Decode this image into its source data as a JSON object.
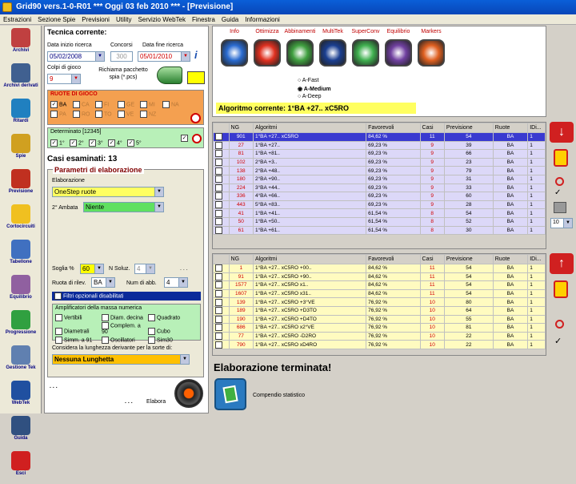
{
  "window": {
    "title": "Grid90 vers.1-0-R01  ***  Oggi 03 feb 2010  ***  - [Previsione]"
  },
  "menu": [
    "Estrazioni",
    "Sezione Spie",
    "Previsioni",
    "Utility",
    "Servizio WebTek",
    "Finestra",
    "Guida",
    "Informazioni"
  ],
  "nav": [
    {
      "label": "Archivi",
      "icon": "book-icon",
      "color": "#c04040"
    },
    {
      "label": "Archivi derivati",
      "icon": "books-icon",
      "color": "#406090"
    },
    {
      "label": "Ritardi",
      "icon": "clock-icon",
      "color": "#2080c0"
    },
    {
      "label": "Spie",
      "icon": "pen-icon",
      "color": "#d0a020"
    },
    {
      "label": "Previsione",
      "icon": "notepad-icon",
      "color": "#c03020"
    },
    {
      "label": "Cortocircuiti",
      "icon": "bulb-icon",
      "color": "#f0c020"
    },
    {
      "label": "Tabellone",
      "icon": "calendar-icon",
      "color": "#4070c0"
    },
    {
      "label": "Equilibrio",
      "icon": "scale-icon",
      "color": "#9060a0"
    },
    {
      "label": "Progressione",
      "icon": "chart-icon",
      "color": "#30a040"
    },
    {
      "label": "Gestione Tek",
      "icon": "tools-icon",
      "color": "#6080b0"
    },
    {
      "label": "WebTek",
      "icon": "globe-icon",
      "color": "#2050a0"
    },
    {
      "label": "Guida",
      "icon": "help-icon",
      "color": "#305080"
    },
    {
      "label": "Esci",
      "icon": "exit-icon",
      "color": "#d02020"
    }
  ],
  "tech": {
    "section": "Tecnica corrente:",
    "start_label": "Data inizio ricerca",
    "start": "05/02/2008",
    "concorsi_label": "Concorsi",
    "concorsi": "300",
    "end_label": "Data fine ricerca",
    "end": "05/01/2010",
    "colpi_label": "Colpi di gioco",
    "colpi": "9",
    "spia_label": "Richiama pacchetto spia (*.pcs)",
    "ruote_title": "RUOTE DI GIOCO",
    "ruote": [
      {
        "n": "BA",
        "on": true
      },
      {
        "n": "CA",
        "on": false
      },
      {
        "n": "FI",
        "on": false
      },
      {
        "n": "GE",
        "on": false
      },
      {
        "n": "MI",
        "on": false
      },
      {
        "n": "NA",
        "on": false
      },
      {
        "n": "PA",
        "on": false
      },
      {
        "n": "RO",
        "on": false
      },
      {
        "n": "TO",
        "on": false
      },
      {
        "n": "VE",
        "on": false
      },
      {
        "n": "NZ",
        "on": false
      }
    ],
    "det_title": "Determinato [12345]",
    "det": [
      "1°",
      "2°",
      "3°",
      "4°",
      "5°"
    ],
    "casi": "Casi esaminati: 13"
  },
  "params": {
    "title": "Parametri di elaborazione",
    "elab_label": "Elaborazione",
    "elab": "OneStep ruote",
    "ambata_label": "2° Ambata",
    "ambata": "Niente",
    "soglia_label": "Soglia %",
    "soglia": "60",
    "nsoluz_label": "N Soluz.",
    "nsoluz": "4",
    "ruota_label": "Ruota di rilev.",
    "ruota": "BA",
    "numabb_label": "Num di abb.",
    "numabb": "4",
    "filtri": "Filtri opzionali disabilitati",
    "ampl_title": "Amplificatori della massa numerica",
    "ampl": [
      "Vertibili",
      "Diam. decina",
      "Quadrato",
      "Diametrali",
      "Complem. a 90",
      "Cubo",
      "Simm. a 91",
      "Oscillatori",
      "Sim30"
    ],
    "lung_label": "Considera la lunghezza derivante per la sorte di:",
    "lung": "Nessuna Lunghetta",
    "elabora": "Elabora",
    "dots": ". . ."
  },
  "algos": {
    "icons": [
      {
        "label": "Info",
        "icon": "question-icon",
        "color": "#2a6bd0"
      },
      {
        "label": "Ottimizza",
        "icon": "flame-icon",
        "color": "#e03020"
      },
      {
        "label": "Abbinamenti",
        "icon": "flower-icon",
        "color": "#40a040"
      },
      {
        "label": "MultiTek",
        "icon": "swirl-icon",
        "color": "#1a3e90"
      },
      {
        "label": "SuperConv",
        "icon": "recycle-icon",
        "color": "#40b050"
      },
      {
        "label": "Equilibrio",
        "icon": "gem-icon",
        "color": "#7040a0"
      },
      {
        "label": "Markers",
        "icon": "ball-icon",
        "color": "#e06020"
      }
    ],
    "modes": [
      "A-Fast",
      "A-Medium",
      "A-Deep"
    ],
    "selected_mode": "A-Medium",
    "current": "Algoritmo corrente:  1°BA +27.. xC5RO"
  },
  "grid1": {
    "headers": [
      "NG",
      "Algoritmi",
      "Favorevoli",
      "Casi",
      "Previsione",
      "Ruote",
      "IDi..."
    ],
    "rows": [
      [
        "901",
        "1°BA +27.. xC5RO",
        "84,62 %",
        "11",
        "54",
        "BA",
        "1"
      ],
      [
        "27",
        "1°BA +27..",
        "69,23 %",
        "9",
        "39",
        "BA",
        "1"
      ],
      [
        "81",
        "1°BA +81..",
        "69,23 %",
        "9",
        "66",
        "BA",
        "1"
      ],
      [
        "102",
        "2°BA +3..",
        "69,23 %",
        "9",
        "23",
        "BA",
        "1"
      ],
      [
        "138",
        "2°BA +48..",
        "69,23 %",
        "9",
        "79",
        "BA",
        "1"
      ],
      [
        "180",
        "2°BA +90..",
        "69,23 %",
        "9",
        "31",
        "BA",
        "1"
      ],
      [
        "224",
        "3°BA +44..",
        "69,23 %",
        "9",
        "33",
        "BA",
        "1"
      ],
      [
        "336",
        "4°BA +66..",
        "69,23 %",
        "9",
        "60",
        "BA",
        "1"
      ],
      [
        "443",
        "5°BA +83..",
        "69,23 %",
        "9",
        "28",
        "BA",
        "1"
      ],
      [
        "41",
        "1°BA +41..",
        "61,54 %",
        "8",
        "54",
        "BA",
        "1"
      ],
      [
        "50",
        "1°BA +50..",
        "61,54 %",
        "8",
        "52",
        "BA",
        "1"
      ],
      [
        "61",
        "1°BA +61..",
        "61,54 %",
        "8",
        "30",
        "BA",
        "1"
      ]
    ]
  },
  "grid2": {
    "headers": [
      "NG",
      "Algoritmi",
      "Favorevoli",
      "Casi",
      "Previsione",
      "Ruote",
      "IDi..."
    ],
    "rows": [
      [
        "1",
        "1°BA +27.. xC5RO +00..",
        "84,62 %",
        "11",
        "54",
        "BA",
        "1"
      ],
      [
        "91",
        "1°BA +27.. xC5RO +90..",
        "84,62 %",
        "11",
        "54",
        "BA",
        "1"
      ],
      [
        "1577",
        "1°BA +27.. xC5RO x1..",
        "84,62 %",
        "11",
        "54",
        "BA",
        "1"
      ],
      [
        "1607",
        "1°BA +27.. xC5RO x31..",
        "84,62 %",
        "11",
        "54",
        "BA",
        "1"
      ],
      [
        "139",
        "1°BA +27.. xC5RO +3°VE",
        "76,92 %",
        "10",
        "80",
        "BA",
        "1"
      ],
      [
        "189",
        "1°BA +27.. xC5RO +D3TO",
        "76,92 %",
        "10",
        "64",
        "BA",
        "1"
      ],
      [
        "190",
        "1°BA +27.. xC5RO +D4TO",
        "76,92 %",
        "10",
        "55",
        "BA",
        "1"
      ],
      [
        "686",
        "1°BA +27.. xC5RO x2°VE",
        "76,92 %",
        "10",
        "81",
        "BA",
        "1"
      ],
      [
        "77",
        "1°BA +27.. xC5RO -D2RO",
        "76,92 %",
        "10",
        "22",
        "BA",
        "1"
      ],
      [
        "790",
        "1°BA +27.. xC5RO xD4RO",
        "76,92 %",
        "10",
        "22",
        "BA",
        "1"
      ]
    ]
  },
  "status": "Elaborazione terminata!",
  "compendio": "Compendio statistico",
  "side": {
    "spin": "10"
  }
}
